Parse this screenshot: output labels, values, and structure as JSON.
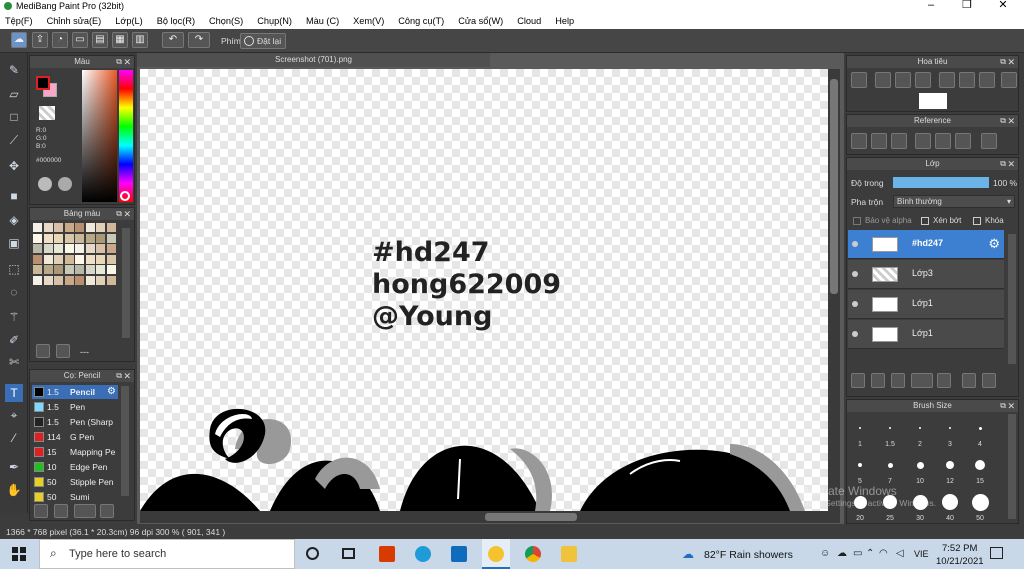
{
  "window": {
    "title": "MediBang Paint Pro (32bit)"
  },
  "menu": [
    "Tệp(F)",
    "Chỉnh sửa(E)",
    "Lớp(L)",
    "Bộ lọc(R)",
    "Chọn(S)",
    "Chụp(N)",
    "Màu (C)",
    "Xem(V)",
    "Công cụ(T)",
    "Cửa sổ(W)",
    "Cloud",
    "Help"
  ],
  "toolbar": {
    "shortcut_label": "Phím",
    "reset_label": "Đặt lại"
  },
  "color_panel": {
    "title": "Màu",
    "r": "R:0",
    "g": "G:0",
    "b": "B:0",
    "hex": "#000000"
  },
  "palette_panel": {
    "title": "Bảng màu",
    "extra": "---"
  },
  "brush_panel": {
    "title": "Cọ: Pencil",
    "items": [
      {
        "size": "1.5",
        "name": "Pencil",
        "color": "#000000"
      },
      {
        "size": "1.5",
        "name": "Pen",
        "color": "#7fd8ff"
      },
      {
        "size": "1.5",
        "name": "Pen (Sharp",
        "color": "#222222"
      },
      {
        "size": "114",
        "name": "G Pen",
        "color": "#e02020"
      },
      {
        "size": "15",
        "name": "Mapping Pe",
        "color": "#e02020"
      },
      {
        "size": "10",
        "name": "Edge Pen",
        "color": "#20c020"
      },
      {
        "size": "50",
        "name": "Stipple Pen",
        "color": "#e8d020"
      },
      {
        "size": "50",
        "name": "Sumi",
        "color": "#e8d020"
      }
    ]
  },
  "document": {
    "tab": "Screenshot (701).png",
    "lines": [
      "#hd247",
      "hong622009",
      "@Young"
    ]
  },
  "status": {
    "text": "1366 * 768 pixel   (36.1 * 20.3cm)   96 dpi   300 %   ( 901, 341 )"
  },
  "navigator": {
    "title": "Hoa tiêu"
  },
  "reference": {
    "title": "Reference"
  },
  "layers": {
    "title": "Lớp",
    "opacity_label": "Độ trong",
    "opacity_value": "100 %",
    "opacity_fraction": 1.0,
    "blend_label": "Pha trộn",
    "blend_value": "Bình thường",
    "protect_alpha": "Bảo vệ alpha",
    "clipping": "Xén bớt",
    "lock": "Khóa",
    "items": [
      {
        "name": "#hd247",
        "selected": true
      },
      {
        "name": "Lớp3",
        "selected": false
      },
      {
        "name": "Lớp1",
        "selected": false
      },
      {
        "name": "Lớp1",
        "selected": false
      }
    ]
  },
  "brush_size": {
    "title": "Brush Size",
    "sizes": [
      "1",
      "1.5",
      "2",
      "3",
      "4",
      "5",
      "7",
      "10",
      "12",
      "15",
      "20",
      "25",
      "30",
      "40",
      "50"
    ]
  },
  "watermark": {
    "line1": "Activate Windows",
    "line2": "Go to Settings to activate Windows."
  },
  "taskbar": {
    "search_placeholder": "Type here to search",
    "weather": "82°F  Rain showers",
    "language": "VIE",
    "time": "7:52 PM",
    "date": "10/21/2021"
  }
}
